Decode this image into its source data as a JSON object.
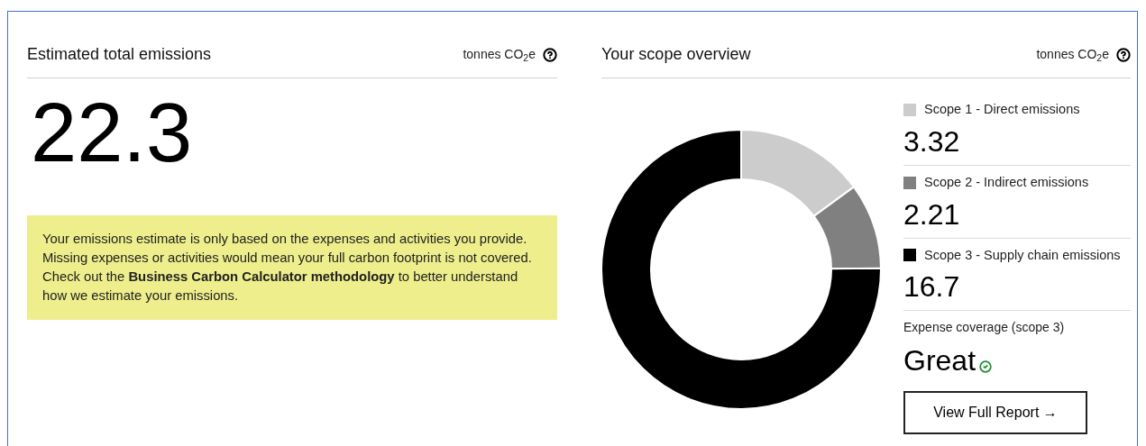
{
  "total": {
    "title": "Estimated total emissions",
    "unit": "tonnes CO$_{2}$e",
    "value": "22.3",
    "notice": "Your emissions estimate is only based on the expenses and activities you provide. Missing expenses or activities would mean your full carbon footprint is not covered. Check out the **Business Carbon Calculator methodology** to better understand how we estimate your emissions."
  },
  "overview": {
    "title": "Your scope overview",
    "unit": "tonnes CO$_{2}$e",
    "chart_data": {
      "type": "donut",
      "categories": [
        "Scope 1 - Direct emissions",
        "Scope 2 - Indirect emissions",
        "Scope 3 - Supply chain emissions"
      ],
      "series": [
        {
          "values": [
            3.32,
            2.21,
            16.7
          ]
        }
      ]
    },
    "scopes": [
      {
        "value": "3.32",
        "color": "#cccccc"
      },
      {
        "value": "2.21",
        "color": "#808080"
      },
      {
        "value": "16.7",
        "color": "#000000"
      }
    ],
    "coverage": {
      "label": "Expense coverage (scope 3)",
      "rating": "Great",
      "good": true
    },
    "button": "View Full Report →"
  }
}
